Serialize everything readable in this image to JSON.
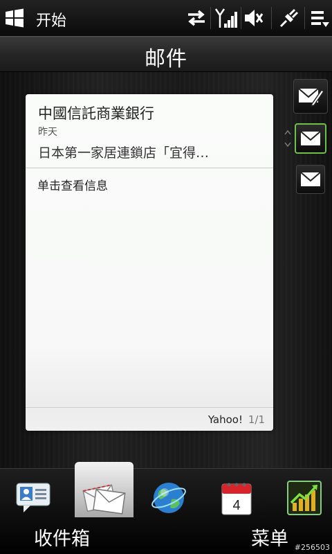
{
  "statusbar": {
    "start_label": "开始",
    "icons": [
      "windows-logo-icon",
      "data-sync-icon",
      "signal-strength-icon",
      "volume-muted-icon",
      "charging-plug-icon",
      "menu-arrow-icon"
    ]
  },
  "title": "邮件",
  "message": {
    "sender": "中國信託商業銀行",
    "date": "昨天",
    "subject": "日本第一家居連鎖店「宜得…",
    "hint": "单击查看信息",
    "account": "Yahoo!",
    "pager": "1/1"
  },
  "side_buttons": [
    "compose-mail-icon",
    "inbox-icon",
    "mail-icon"
  ],
  "tabs": [
    {
      "name": "contacts",
      "icon": "contact-card-icon"
    },
    {
      "name": "mail",
      "icon": "mail-envelope-icon",
      "active": true
    },
    {
      "name": "internet",
      "icon": "globe-icon"
    },
    {
      "name": "calendar",
      "icon": "calendar-icon",
      "day": "4"
    },
    {
      "name": "stocks",
      "icon": "stock-chart-icon"
    }
  ],
  "softkeys": {
    "left": "收件箱",
    "right": "菜单"
  },
  "watermark": "#256503",
  "colors": {
    "card_bg": "#f8f9f8",
    "accent_green": "#6cc24a",
    "calendar_red": "#d9232a"
  }
}
